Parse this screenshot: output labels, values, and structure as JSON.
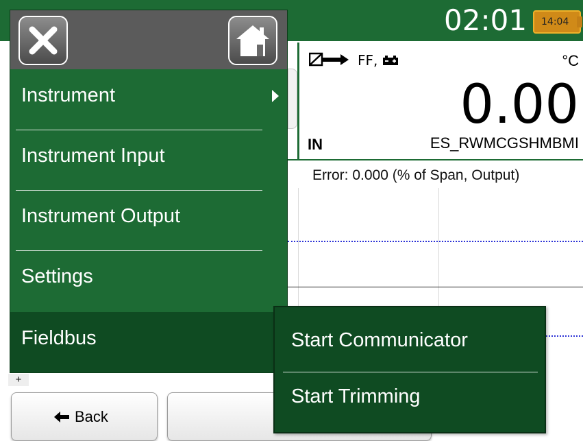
{
  "status_bar": {
    "clock": "02:01",
    "battery_time": "14:04"
  },
  "measurement": {
    "function_text": "FF,",
    "unit": "°C",
    "value": "0.00",
    "direction": "IN",
    "tag": "ES_RWMCGSHMBMI"
  },
  "error_text": "Error: 0.000 (% of Span, Output)",
  "corner_marker": "+",
  "menu": {
    "items": [
      {
        "label": "Instrument",
        "has_submenu": true
      },
      {
        "label": "Instrument Input",
        "has_submenu": false
      },
      {
        "label": "Instrument Output",
        "has_submenu": false
      },
      {
        "label": "Settings",
        "has_submenu": false
      },
      {
        "label": "Fieldbus",
        "has_submenu": false,
        "selected": true
      }
    ]
  },
  "submenu": {
    "items": [
      {
        "label": "Start Communicator"
      },
      {
        "label": "Start Trimming"
      }
    ]
  },
  "buttons": {
    "back_label": "Back"
  },
  "colors": {
    "accent": "#1d6b34",
    "selected": "#0f4b22",
    "header": "#5b5b5b",
    "graph_dotted": "#2c32d6",
    "battery": "#d08a18"
  },
  "icons": {
    "close": "close-icon",
    "home": "home-icon",
    "back": "left-arrow-icon",
    "submenu": "chevron-right-icon"
  }
}
